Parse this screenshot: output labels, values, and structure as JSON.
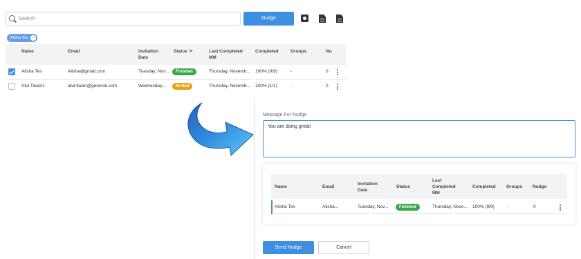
{
  "colors": {
    "primary": "#3f8fe0",
    "finished": "#3aa84a",
    "invited": "#e8a21a",
    "chip": "#6a9ee8"
  },
  "top": {
    "search_placeholder": "Search",
    "nudge_label": "Nudge",
    "chip_label": "Alisha Tes",
    "chip_close": "×",
    "columns": [
      "Name",
      "Email",
      "Invitation Date",
      "Status",
      "Last Completed MM",
      "Completed",
      "Groups",
      "Nu"
    ],
    "rows": [
      {
        "name": "Alisha Tes",
        "email": "Alisha@gmail.com",
        "invitation_date": "Tuesday, Nov...",
        "status": "Finished",
        "last_completed": "Thursday, Novemb...",
        "completed": "100% (9/9)",
        "groups": "-",
        "nudge": "0"
      },
      {
        "name": "Atul Tiwari1",
        "email": "atul.tiwari@geneste.com",
        "invitation_date": "Wednesday...",
        "status": "Invited",
        "last_completed": "Thursday, Novemb...",
        "completed": "100% (1/1)",
        "groups": "-",
        "nudge": "0"
      }
    ]
  },
  "bottom": {
    "message_label": "Message For Nudge",
    "message_value": "You are doing great!",
    "columns": [
      "Name",
      "Email",
      "Invitation Date",
      "Status",
      "Last Completed MM",
      "Completed",
      "Groups",
      "Nudge"
    ],
    "row": {
      "name": "Alisha Tes",
      "email": "Alisha...",
      "invitation_date": "Tuesday, Nov...",
      "status": "Finished",
      "last_completed": "Thursday, Nove...",
      "completed": "100% (9/9)",
      "groups": "-",
      "nudge": "0"
    },
    "send_label": "Send Nudge",
    "cancel_label": "Cancel"
  }
}
